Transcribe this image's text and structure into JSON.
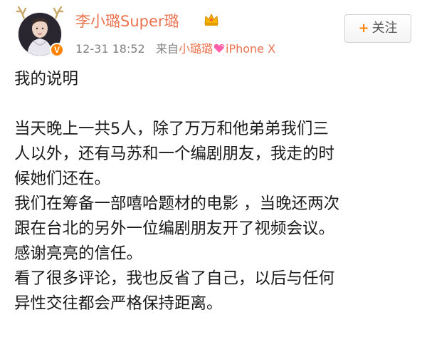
{
  "post": {
    "author": {
      "name": "李小璐Super璐",
      "verified_badge": "V",
      "verified_color": "#ff8200",
      "name_color": "#eb7350",
      "crown_icon": "crown-icon"
    },
    "meta": {
      "timestamp": "12-31 18:52",
      "source_prefix": "来自",
      "source_name": "小璐璐",
      "heart_icon": "heart-icon",
      "device": "iPhone X"
    },
    "follow_button": {
      "icon": "+",
      "label": "关注"
    },
    "content": {
      "title": "我的说明",
      "lines": [
        "当天晚上一共5人，除了万万和他弟弟我们三",
        "人以外，还有马苏和一个编剧朋友，我走的时",
        "候她们还在。",
        "我们在筹备一部嘻哈题材的电影 ，当晚还两次",
        "跟在台北的另外一位编剧朋友开了视频会议。",
        "感谢亮亮的信任。",
        "看了很多评论，我也反省了自己，以后与任何",
        "异性交往都会严格保持距离。"
      ]
    }
  }
}
